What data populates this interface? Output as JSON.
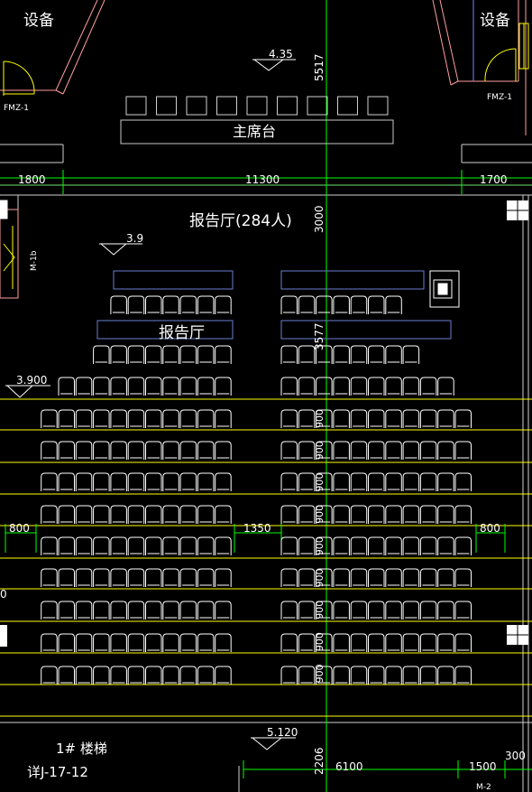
{
  "labels": {
    "equipment_left": "设备",
    "equipment_right": "设备",
    "door_left": "FMZ-1",
    "door_right": "FMZ-1",
    "door_side": "M-1b",
    "door_bottom": "M-2",
    "podium": "主席台",
    "hall_capacity": "报告厅(284人)",
    "hall_name": "报告厅",
    "stair_name": "1# 楼梯",
    "stair_ref": "详J-17-12",
    "left_edge_fragment": "0"
  },
  "elevations": {
    "podium": "4.35",
    "stage_front": "3.9",
    "hall_left": "3.900",
    "rear": "5.120"
  },
  "dimensions": {
    "top_left": "1800",
    "top_middle": "11300",
    "top_right": "1700",
    "aisle_left": "800",
    "aisle_center": "1350",
    "aisle_right": "800",
    "bottom_middle": "6100",
    "bottom_right_a": "1500",
    "bottom_right_b": "300",
    "vertical_stage": "5517",
    "vertical_front": "3000",
    "vertical_gap": "3577",
    "row_spacings": [
      "900",
      "900",
      "900",
      "900",
      "900",
      "900",
      "900",
      "900",
      "900"
    ],
    "vertical_rear": "2206"
  },
  "seating": {
    "podium_chairs": 9,
    "left_block_rows": [
      7,
      8,
      10,
      11,
      11,
      11,
      11,
      11,
      11,
      11,
      11,
      11
    ],
    "right_block_rows": [
      7,
      8,
      10,
      11,
      11,
      11,
      11,
      11,
      11,
      11,
      11,
      11
    ]
  },
  "colors": {
    "background": "#000000",
    "axis_line": "#00ff00",
    "row_line": "#ffff00",
    "seat": "#ffffff",
    "table": "#6a7fd0",
    "wall": "#ff9e9e",
    "door_arc": "#ffff00",
    "text": "#ffffff",
    "podium_outline": "#c8c8c8"
  }
}
